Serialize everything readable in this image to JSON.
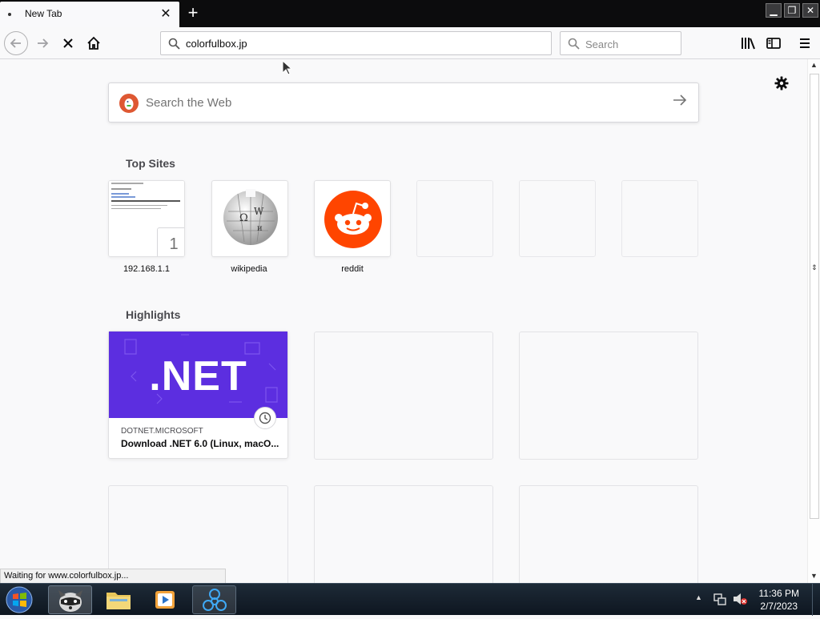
{
  "tab": {
    "title": "New Tab"
  },
  "window_controls": {
    "minimize": "▁",
    "restore": "❐",
    "close": "✕"
  },
  "toolbar": {
    "url": "colorfulbox.jp",
    "search_placeholder": "Search"
  },
  "newtab": {
    "search_placeholder": "Search the Web",
    "top_sites_title": "Top Sites",
    "top_sites": [
      {
        "label": "192.168.1.1",
        "badge": "1"
      },
      {
        "label": "wikipedia"
      },
      {
        "label": "reddit"
      }
    ],
    "highlights_title": "Highlights",
    "highlight": {
      "image_text": ".NET",
      "source": "DOTNET.MICROSOFT",
      "title": "Download .NET 6.0 (Linux, macO..."
    }
  },
  "status_text": "Waiting for www.colorfulbox.jp...",
  "taskbar": {
    "time": "11:36 PM",
    "date": "2/7/2023"
  },
  "colors": {
    "reddit": "#ff4500",
    "dotnet": "#5c2ee0",
    "ddg": "#de5833"
  }
}
